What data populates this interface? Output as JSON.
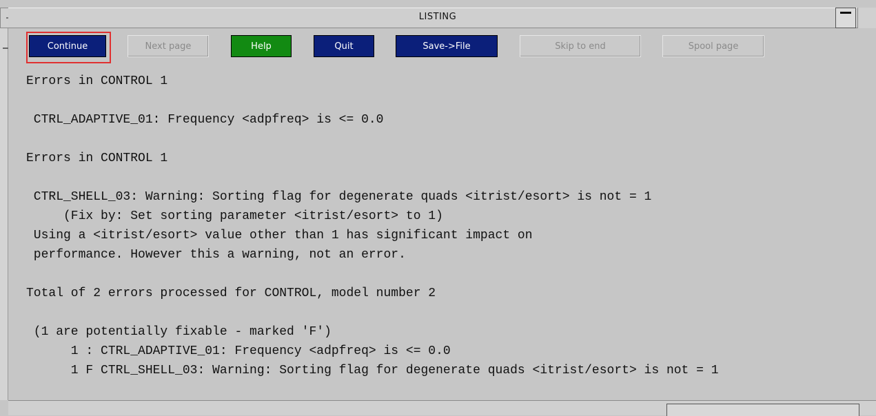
{
  "window": {
    "title": "LISTING"
  },
  "toolbar": {
    "continue_label": "Continue",
    "next_page_label": "Next page",
    "help_label": "Help",
    "quit_label": "Quit",
    "save_file_label": "Save->File",
    "skip_to_end_label": "Skip to end",
    "spool_page_label": "Spool page"
  },
  "listing": {
    "lines": [
      "Errors in CONTROL 1",
      " CTRL_ADAPTIVE_01: Frequency <adpfreq> is <= 0.0",
      "Errors in CONTROL 1",
      " CTRL_SHELL_03: Warning: Sorting flag for degenerate quads <itrist/esort> is not = 1",
      "     (Fix by: Set sorting parameter <itrist/esort> to 1)",
      " Using a <itrist/esort> value other than 1 has significant impact on",
      " performance. However this a warning, not an error.",
      "Total of 2 errors processed for CONTROL, model number 2",
      " (1 are potentially fixable - marked 'F')",
      "      1 : CTRL_ADAPTIVE_01: Frequency <adpfreq> is <= 0.0",
      "      1 F CTRL_SHELL_03: Warning: Sorting flag for degenerate quads <itrist/esort> is not = 1"
    ]
  },
  "colors": {
    "background": "#c6c6c6",
    "button_blue": "#0b1f7a",
    "button_green": "#128a12",
    "focus_ring": "#e03030"
  },
  "icons": {
    "window_menu": "window-menu-icon",
    "minimize": "minimize-icon",
    "maximize": "maximize-icon"
  }
}
